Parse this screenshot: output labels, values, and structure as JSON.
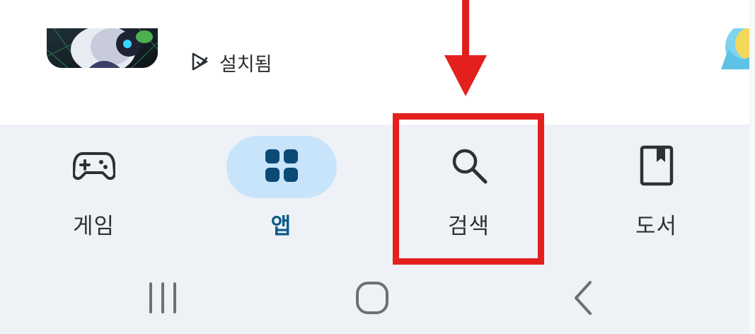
{
  "app_list": {
    "installed_status": "설치됨"
  },
  "bottom_nav": {
    "items": [
      {
        "label": "게임",
        "icon": "gamepad-icon",
        "active": false
      },
      {
        "label": "앱",
        "icon": "apps-grid-icon",
        "active": true
      },
      {
        "label": "검색",
        "icon": "search-icon",
        "active": false
      },
      {
        "label": "도서",
        "icon": "book-icon",
        "active": false
      }
    ]
  },
  "system_nav": {
    "buttons": [
      "recents-icon",
      "home-icon",
      "back-icon"
    ]
  },
  "colors": {
    "nav_background": "#eef2f6",
    "active_pill": "#c7e4fb",
    "active_label": "#0b5a8a",
    "annotation_red": "#e3201e"
  }
}
